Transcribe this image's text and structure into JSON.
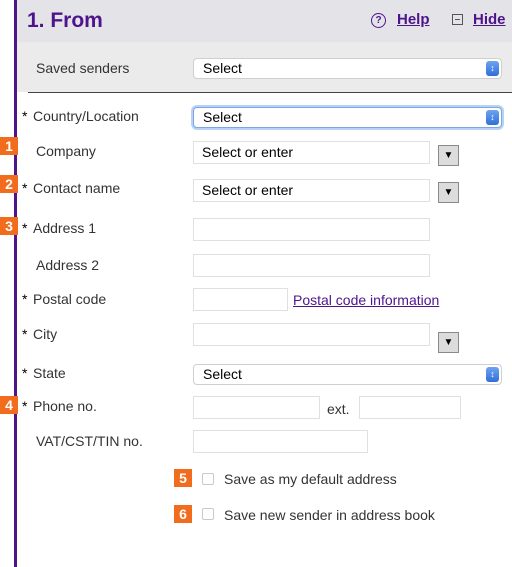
{
  "section": {
    "title": "1. From",
    "help_label": "Help",
    "hide_label": "Hide"
  },
  "icons": {
    "help": "help-circle-icon",
    "hide": "collapse-square-icon",
    "dropdown": "chevron-down-icon"
  },
  "colors": {
    "brand": "#4d148c",
    "badge": "#f26c1e",
    "header_bg": "#e3e3e8"
  },
  "required_marker": "*",
  "saved_senders": {
    "label": "Saved senders",
    "value": "Select"
  },
  "country": {
    "label": "Country/Location",
    "value": "Select"
  },
  "company": {
    "label": "Company",
    "placeholder": "Select or enter"
  },
  "contact": {
    "label": "Contact name",
    "placeholder": "Select or enter"
  },
  "address1": {
    "label": "Address 1",
    "value": ""
  },
  "address2": {
    "label": "Address 2",
    "value": ""
  },
  "postal": {
    "label": "Postal code",
    "value": "",
    "link": "Postal code information"
  },
  "city": {
    "label": "City",
    "value": ""
  },
  "state": {
    "label": "State",
    "value": "Select"
  },
  "phone": {
    "label": "Phone no.",
    "value": "",
    "ext_label": "ext.",
    "ext_value": ""
  },
  "vat": {
    "label": "VAT/CST/TIN no.",
    "value": ""
  },
  "checkboxes": [
    {
      "label": "Save as my default address",
      "checked": false
    },
    {
      "label": "Save new sender in address book",
      "checked": false
    }
  ],
  "badges": [
    "1",
    "2",
    "3",
    "4",
    "5",
    "6"
  ]
}
